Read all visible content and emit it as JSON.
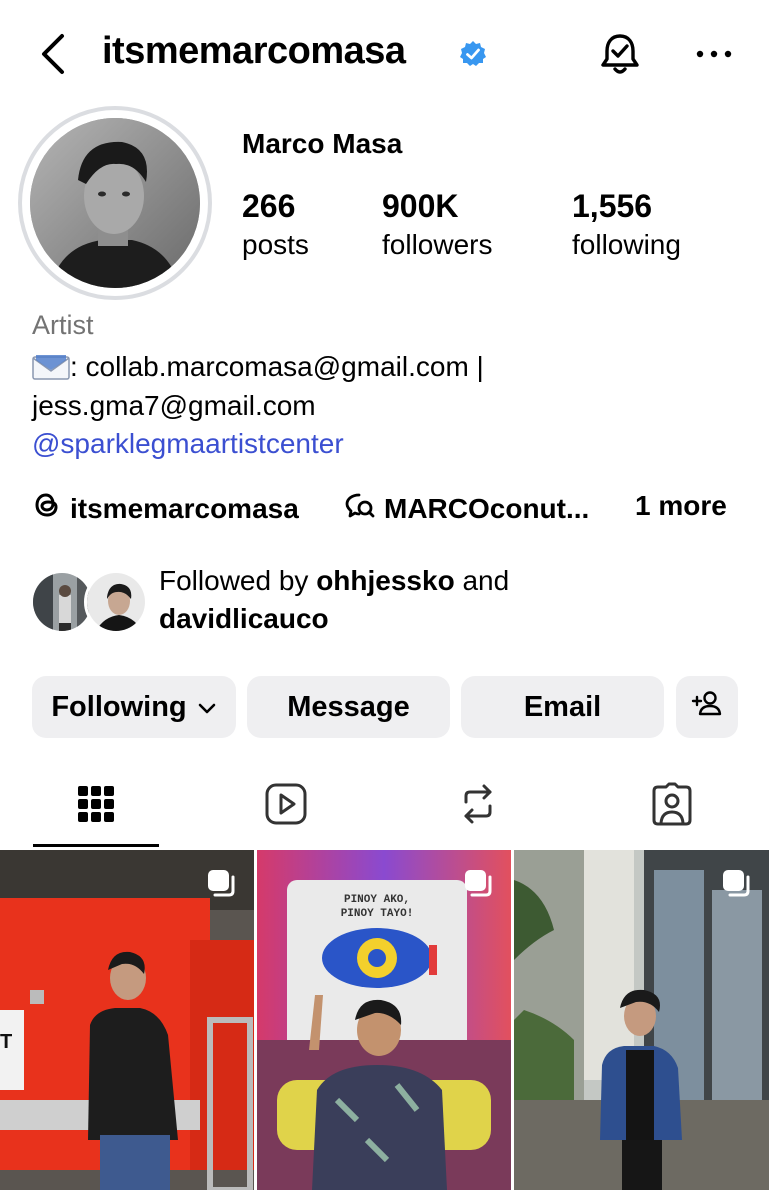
{
  "header": {
    "username": "itsmemarcomasa",
    "verified": true,
    "icons": [
      "back-arrow-icon",
      "verified-badge-icon",
      "notification-bell-icon",
      "more-horizontal-icon"
    ]
  },
  "profile": {
    "full_name": "Marco Masa",
    "stats": [
      {
        "value": "266",
        "label": "posts"
      },
      {
        "value": "900K",
        "label": "followers"
      },
      {
        "value": "1,556",
        "label": "following"
      }
    ]
  },
  "bio": {
    "category": "Artist",
    "line1": ": collab.marcomasa@gmail.com |",
    "line2": "jess.gma7@gmail.com",
    "mention": "@sparklegmaartistcenter"
  },
  "links": {
    "threads": "itsmemarcomasa",
    "channel": "MARCOconut...",
    "more": "1 more"
  },
  "mutuals": {
    "prefix": "Followed by ",
    "user1": "ohhjessko",
    "joiner": " and",
    "user2": "davidlicauco"
  },
  "actions": {
    "following": "Following",
    "message": "Message",
    "email": "Email"
  },
  "tabs": [
    "grid-icon",
    "reels-icon",
    "reposts-icon",
    "tagged-icon"
  ],
  "grid": {
    "post2_sign_line1": "PINOY AKO,",
    "post2_sign_line2": "PINOY TAYO!",
    "post1_sign": "T"
  },
  "colors": {
    "link": "#3b4fd1",
    "verified": "#3897f0",
    "button_bg": "#efeff1",
    "secondary_text": "#737373"
  }
}
